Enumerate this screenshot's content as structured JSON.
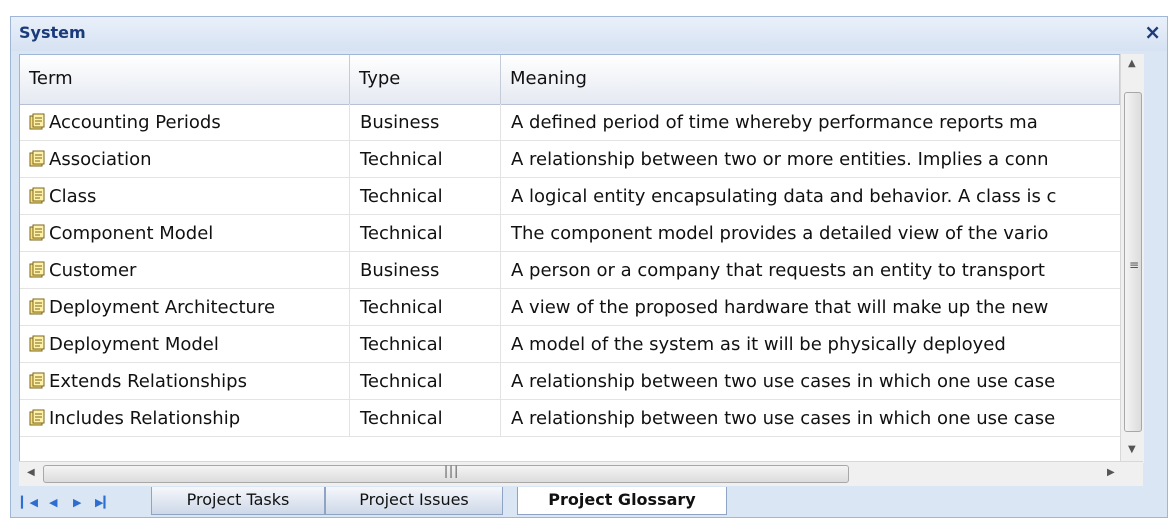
{
  "window": {
    "title": "System",
    "close_label": "×"
  },
  "columns": [
    "Term",
    "Type",
    "Meaning"
  ],
  "rows": [
    {
      "term": "Accounting Periods",
      "type": "Business",
      "meaning": "A defined period of time whereby performance  reports ma"
    },
    {
      "term": "Association",
      "type": "Technical",
      "meaning": "A relationship between two or more entities. Implies a conn"
    },
    {
      "term": "Class",
      "type": "Technical",
      "meaning": "A logical entity encapsulating data and behavior. A class is c"
    },
    {
      "term": "Component Model",
      "type": "Technical",
      "meaning": "The component model provides a detailed view of the vario"
    },
    {
      "term": "Customer",
      "type": "Business",
      "meaning": "A person or a company that requests an entity to transport"
    },
    {
      "term": "Deployment Architecture",
      "type": "Technical",
      "meaning": "A view of the proposed hardware that will make up the new"
    },
    {
      "term": "Deployment Model",
      "type": "Technical",
      "meaning": "A model of the system as it will be physically deployed"
    },
    {
      "term": "Extends Relationships",
      "type": "Technical",
      "meaning": "A relationship between two use cases in which one use case"
    },
    {
      "term": "Includes Relationship",
      "type": "Technical",
      "meaning": "A relationship between two use cases in which one use case"
    }
  ],
  "tabs": [
    {
      "label": "Project Tasks",
      "active": false
    },
    {
      "label": "Project Issues",
      "active": false
    },
    {
      "label": "Project Glossary",
      "active": true
    }
  ],
  "icons": {
    "row_icon": "glossary-term-icon",
    "nav": [
      "first-tab-icon",
      "prev-tab-icon",
      "next-tab-icon",
      "last-tab-icon"
    ]
  },
  "colors": {
    "title": "#1b3a7a",
    "accent": "#2d6fd0"
  }
}
